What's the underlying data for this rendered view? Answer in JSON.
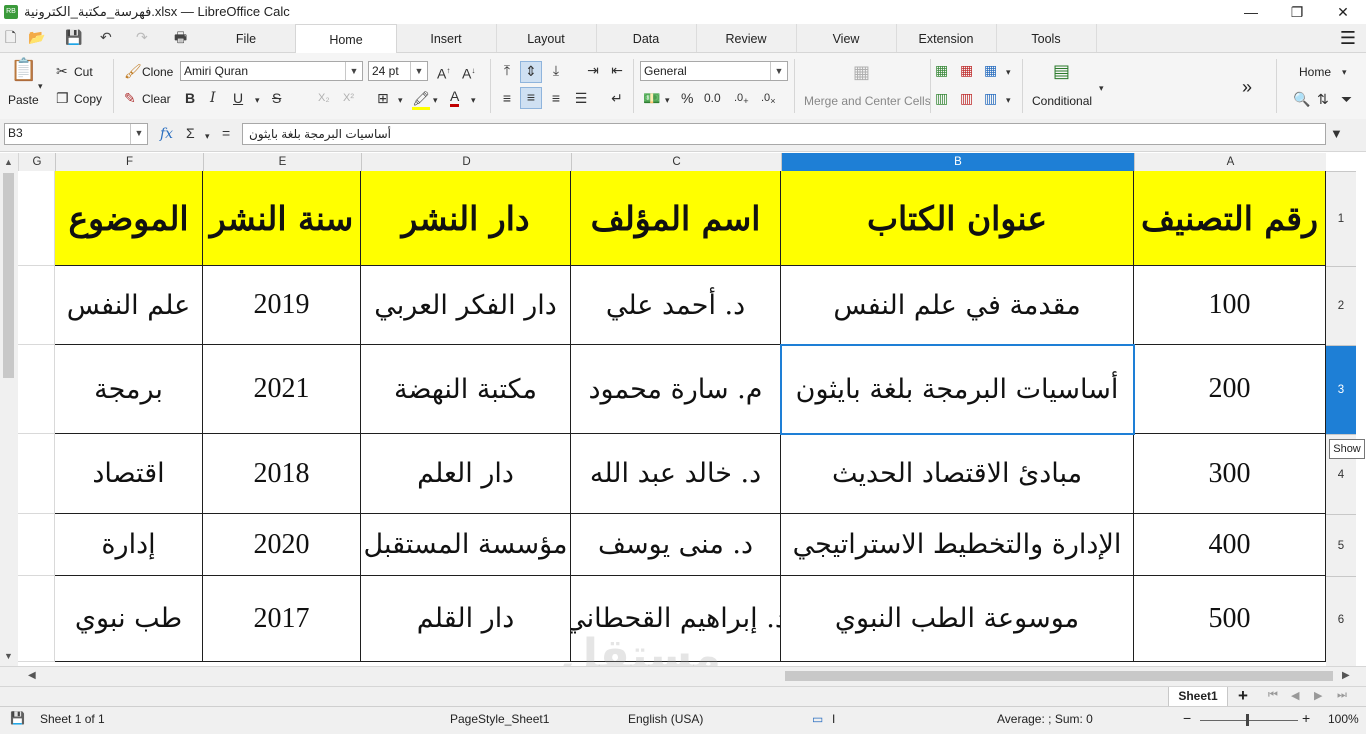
{
  "window": {
    "title": "فهرسة_مكتبة_الكترونية.xlsx — LibreOffice Calc",
    "app_icon_label": "RB",
    "minimize": "—",
    "maximize": "❐",
    "close": "✕"
  },
  "tabs": [
    "File",
    "Home",
    "Insert",
    "Layout",
    "Data",
    "Review",
    "View",
    "Extension",
    "Tools"
  ],
  "active_tab": "Home",
  "ribbon": {
    "paste": "Paste",
    "cut": "Cut",
    "copy": "Copy",
    "clone": "Clone",
    "clear": "Clear",
    "font_name": "Amiri Quran",
    "font_size": "24 pt",
    "number_format": "General",
    "merge_center": "Merge and Center Cells",
    "conditional": "Conditional",
    "home_dropdown": "Home",
    "more": "»"
  },
  "formula_bar": {
    "name_box": "B3",
    "content": "أساسيات البرمجة بلغة بايثون"
  },
  "columns": [
    "G",
    "F",
    "E",
    "D",
    "C",
    "B",
    "A"
  ],
  "rows": [
    "1",
    "2",
    "3",
    "4",
    "5",
    "6"
  ],
  "table": {
    "headers": [
      "رقم التصنيف",
      "عنوان الكتاب",
      "اسم المؤلف",
      "دار النشر",
      "سنة النشر",
      "الموضوع"
    ],
    "rows": [
      [
        "100",
        "مقدمة في علم النفس",
        "د. أحمد علي",
        "دار الفكر العربي",
        "2019",
        "علم النفس"
      ],
      [
        "200",
        "أساسيات البرمجة بلغة بايثون",
        "م. سارة محمود",
        "مكتبة النهضة",
        "2021",
        "برمجة"
      ],
      [
        "300",
        "مبادئ الاقتصاد الحديث",
        "د. خالد عبد الله",
        "دار العلم",
        "2018",
        "اقتصاد"
      ],
      [
        "400",
        "الإدارة والتخطيط الاستراتيجي",
        "د. منى يوسف",
        "مؤسسة المستقبل",
        "2020",
        "إدارة"
      ],
      [
        "500",
        "موسوعة الطب النبوي",
        "د. إبراهيم القحطاني",
        "دار القلم",
        "2017",
        "طب نبوي"
      ]
    ]
  },
  "sheet_tab": "Sheet1",
  "status": {
    "sheet": "Sheet 1 of 1",
    "page_style": "PageStyle_Sheet1",
    "language": "English (USA)",
    "summary": "Average: ; Sum: 0",
    "zoom": "100%"
  },
  "tooltip": "Show",
  "watermark": "مستقل",
  "watermark_sub": "mostaql.com",
  "colors": {
    "header_fill": "#ffff00",
    "selection": "#1e7fd6"
  }
}
